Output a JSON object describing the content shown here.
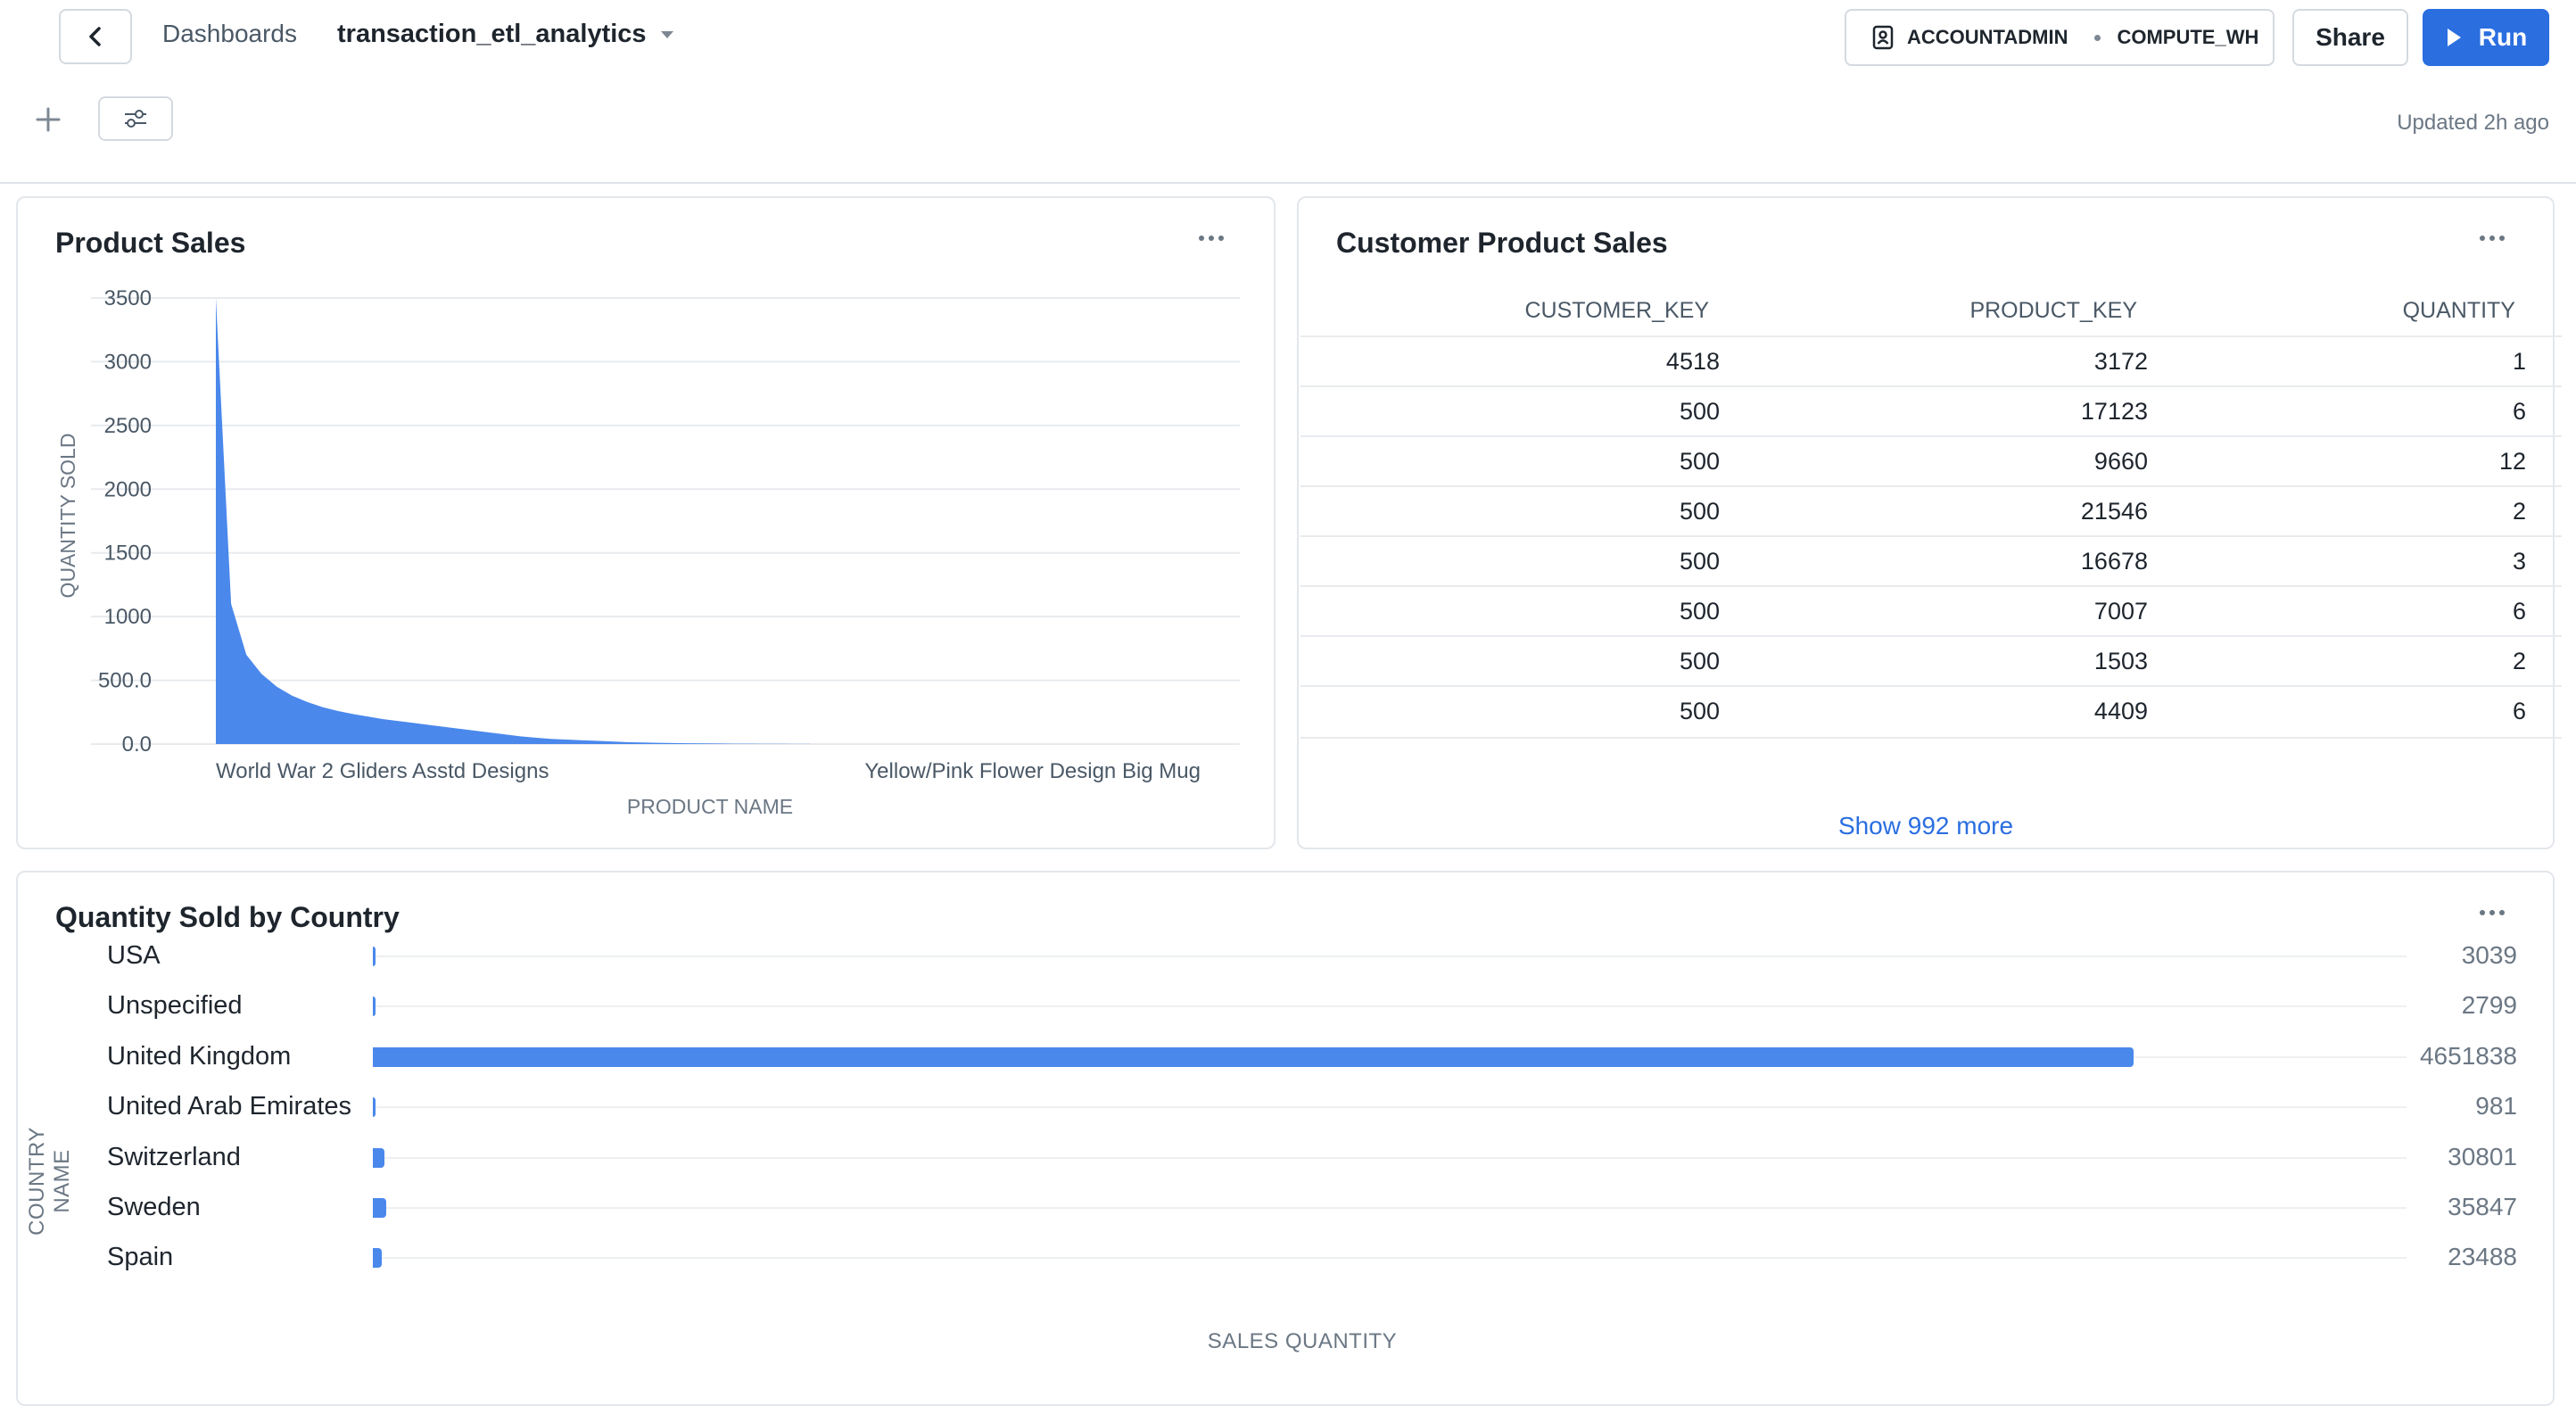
{
  "header": {
    "breadcrumb": "Dashboards",
    "title": "transaction_etl_analytics",
    "role": "ACCOUNTADMIN",
    "warehouse": "COMPUTE_WH",
    "share_label": "Share",
    "run_label": "Run",
    "updated": "Updated 2h ago",
    "accent_color": "#2a6ee0"
  },
  "product_sales": {
    "title": "Product Sales",
    "chart_data": {
      "type": "area",
      "xlabel": "PRODUCT NAME",
      "ylabel": "QUANTITY SOLD",
      "ylim": [
        0,
        3500
      ],
      "yticks": [
        "3500",
        "3000",
        "2500",
        "2000",
        "1500",
        "1000",
        "500.0",
        "0.0"
      ],
      "x_tick_labels": [
        "World War 2 Gliders Asstd Designs",
        "Yellow/Pink Flower Design Big Mug"
      ],
      "values": [
        3500,
        1100,
        700,
        550,
        450,
        380,
        330,
        290,
        260,
        235,
        215,
        195,
        180,
        165,
        150,
        135,
        120,
        105,
        90,
        75,
        60,
        50,
        40,
        35,
        30,
        25,
        20,
        15,
        12,
        10,
        8,
        6,
        5,
        4,
        3,
        3,
        2,
        2,
        1,
        1
      ],
      "color": "#4a88ec"
    }
  },
  "customer_sales": {
    "title": "Customer Product Sales",
    "columns": [
      "CUSTOMER_KEY",
      "PRODUCT_KEY",
      "QUANTITY"
    ],
    "rows": [
      [
        "4518",
        "3172",
        "1"
      ],
      [
        "500",
        "17123",
        "6"
      ],
      [
        "500",
        "9660",
        "12"
      ],
      [
        "500",
        "21546",
        "2"
      ],
      [
        "500",
        "16678",
        "3"
      ],
      [
        "500",
        "7007",
        "6"
      ],
      [
        "500",
        "1503",
        "2"
      ],
      [
        "500",
        "4409",
        "6"
      ]
    ],
    "show_more": "Show 992 more"
  },
  "country": {
    "title": "Quantity Sold by Country",
    "chart_data": {
      "type": "bar",
      "orientation": "horizontal",
      "xlabel": "SALES QUANTITY",
      "ylabel": "COUNTRY NAME",
      "categories": [
        "USA",
        "Unspecified",
        "United Kingdom",
        "United Arab Emirates",
        "Switzerland",
        "Sweden",
        "Spain"
      ],
      "values": [
        3039,
        2799,
        4651838,
        981,
        30801,
        35847,
        23488
      ],
      "value_labels": [
        "3039",
        "2799",
        "4651838",
        "981",
        "30801",
        "35847",
        "23488"
      ],
      "xlim": [
        0,
        5000000
      ],
      "color": "#4a88ec"
    }
  }
}
